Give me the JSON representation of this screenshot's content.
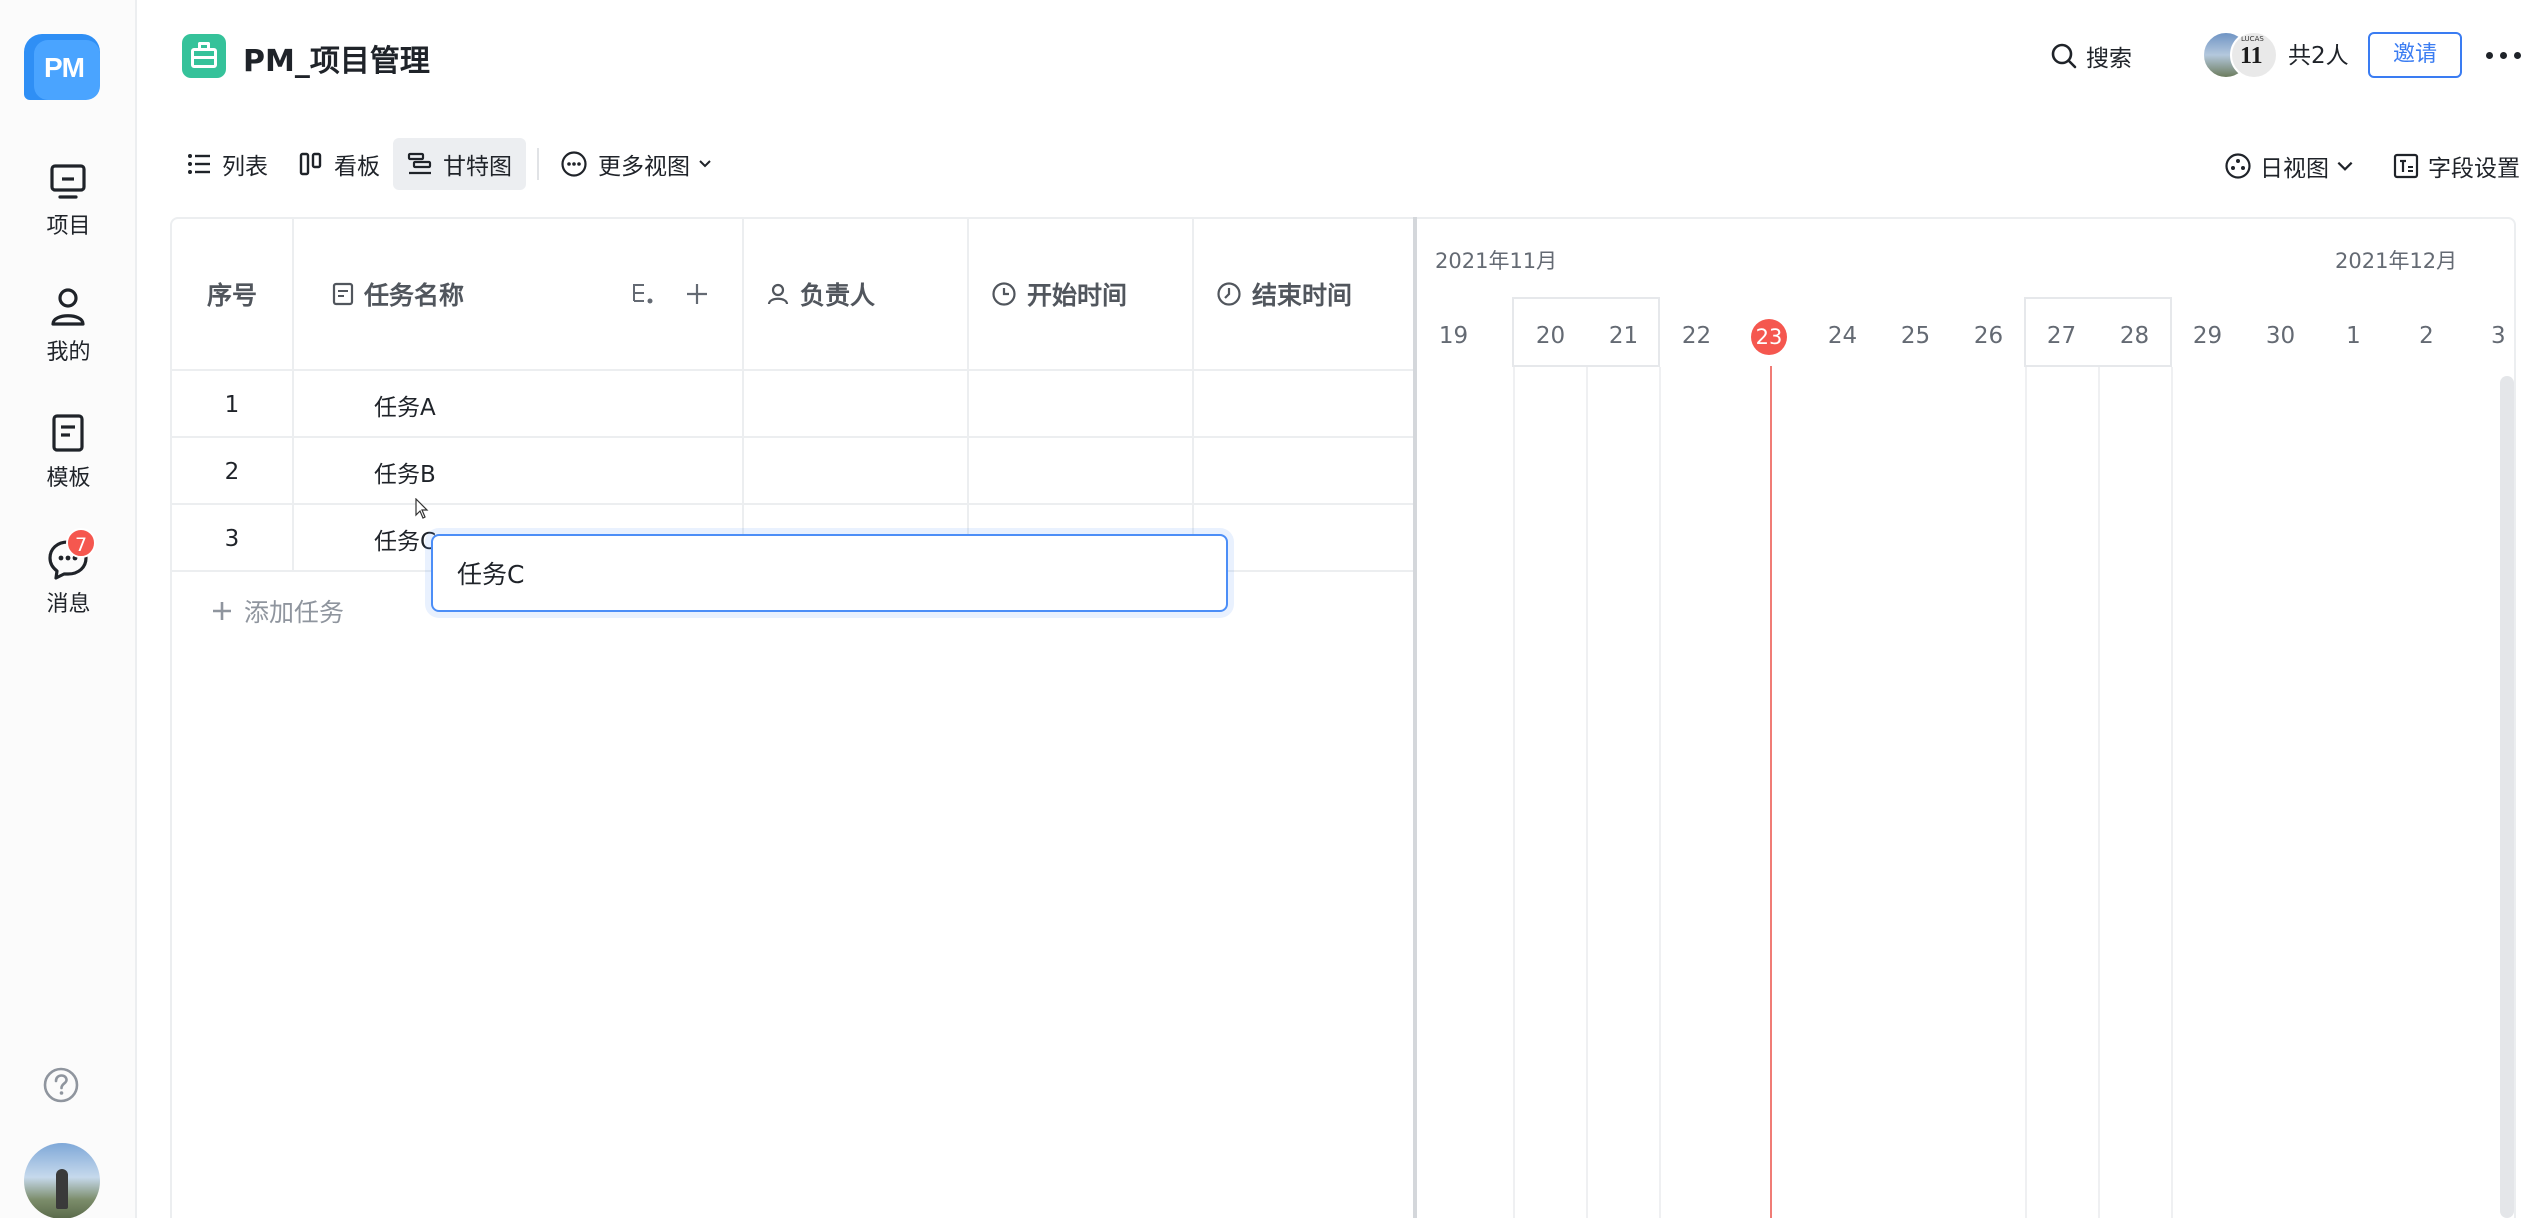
{
  "sidebar": {
    "logo_text": "PM",
    "items": [
      {
        "label": "项目",
        "icon": "monitor-icon"
      },
      {
        "label": "我的",
        "icon": "user-icon"
      },
      {
        "label": "模板",
        "icon": "template-icon"
      },
      {
        "label": "消息",
        "icon": "message-icon",
        "badge": "7"
      }
    ],
    "help_icon": "help-icon"
  },
  "header": {
    "project_title": "PM_项目管理",
    "search_label": "搜索",
    "members_label": "共2人",
    "invite_label": "邀请",
    "avatar_2_text": "11",
    "avatar_2_caption": "LUCAS"
  },
  "views": {
    "tabs": [
      {
        "label": "列表",
        "icon": "list-icon"
      },
      {
        "label": "看板",
        "icon": "kanban-icon"
      },
      {
        "label": "甘特图",
        "icon": "gantt-icon",
        "active": true
      },
      {
        "label": "更多视图",
        "icon": "more-views-icon"
      }
    ],
    "day_view_label": "日视图",
    "field_settings_label": "字段设置"
  },
  "table": {
    "columns": [
      "序号",
      "任务名称",
      "负责人",
      "开始时间",
      "结束时间"
    ],
    "rows": [
      {
        "index": "1",
        "name": "任务A"
      },
      {
        "index": "2",
        "name": "任务B"
      },
      {
        "index": "3",
        "name": "任务C"
      }
    ],
    "add_task_label": "添加任务",
    "editing_value": "任务C"
  },
  "gantt": {
    "months": [
      "2021年11月",
      "2021年12月"
    ],
    "days": [
      "19",
      "20",
      "21",
      "22",
      "23",
      "24",
      "25",
      "26",
      "27",
      "28",
      "29",
      "30",
      "1",
      "2",
      "3"
    ],
    "today": "23",
    "accent_color": "#f5574f",
    "primary_color": "#3a7cf2"
  }
}
